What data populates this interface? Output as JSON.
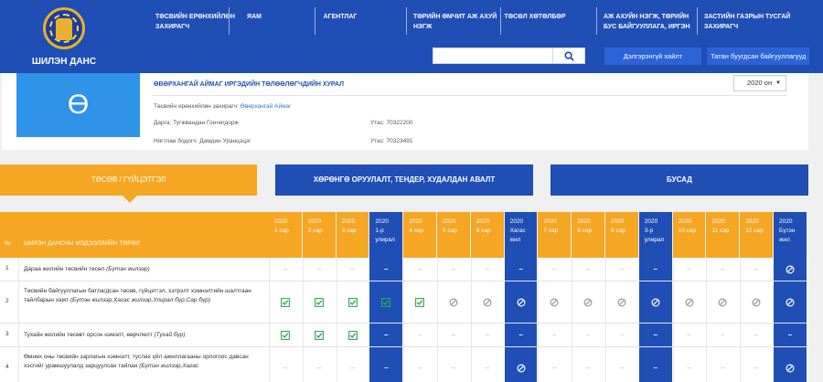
{
  "site": {
    "title": "ШИЛЭН ДАНС"
  },
  "nav": [
    {
      "line1": "ТӨСВИЙН ЕРӨНХИЙЛӨН",
      "line2": "ЗАХИРАГЧ"
    },
    {
      "line1": "ЯАМ",
      "line2": ""
    },
    {
      "line1": "АГЕНТЛАГ",
      "line2": ""
    },
    {
      "line1": "ТӨРИЙН ӨМЧИТ АЖ АХУЙ",
      "line2": "НЭГЖ"
    },
    {
      "line1": "ТӨСӨЛ ХӨТӨЛБӨР",
      "line2": ""
    },
    {
      "line1": "АЖ АХУЙН НЭГЖ, ТӨРИЙН",
      "line2": "БУС БАЙГУУЛЛАГА, ИРГЭН"
    },
    {
      "line1": "ЗАСТИЙН ГАЗРЫН ТУСГАЙ",
      "line2": "ЗАХИРАГЧ"
    }
  ],
  "search": {
    "value": "",
    "placeholder": ""
  },
  "buttons": {
    "advanced": "Дэлгэрэнгүй хайлт",
    "download": "Татан буугдсан байгууллагууд"
  },
  "org": {
    "initial": "Ө",
    "name": "ӨВӨРХАНГАЙ АЙМАГ ИРГЭДИЙН ТӨЛӨӨЛӨГЧДИЙН ХУРАЛ",
    "year": "2020 он",
    "manager_label": "Төсвийн ерөнхийлөн захирагч:",
    "manager_value": "Өвөрхангай Аймаг",
    "head": "Дарга: Тугжвандан Гончигдорж",
    "head_phone": "Утас: 70322200",
    "accountant": "Нягтлан бодогч: Дамдин Уранцэцэг",
    "accountant_phone": "Утас: 70323491"
  },
  "tabs": {
    "budget": "ТӨСӨВ / ГҮЙЦЭТГЭЛ",
    "procurement": "ХӨРӨНГӨ ОРУУЛАЛТ, ТЕНДЕР, ХУДАЛДАН АВАЛТ",
    "other": "БУСАД"
  },
  "table": {
    "num_header": "№",
    "label_header": "ШИЛЭН ДАНСНЫ МЭДЭЭЛЛИЙН ТӨРӨЛ",
    "columns": [
      {
        "top": "2020",
        "bottom": "1 сар",
        "kind": "month"
      },
      {
        "top": "2020",
        "bottom": "2 сар",
        "kind": "month"
      },
      {
        "top": "2020",
        "bottom": "3 сар",
        "kind": "month"
      },
      {
        "top": "2020",
        "bottom": "1-р",
        "extra": "улирал",
        "kind": "period"
      },
      {
        "top": "2020",
        "bottom": "4 сар",
        "kind": "month"
      },
      {
        "top": "2020",
        "bottom": "5 сар",
        "kind": "month"
      },
      {
        "top": "2020",
        "bottom": "6 сар",
        "kind": "month"
      },
      {
        "top": "2020",
        "bottom": "Хагас",
        "extra": "жил",
        "kind": "period"
      },
      {
        "top": "2020",
        "bottom": "7 сар",
        "kind": "month"
      },
      {
        "top": "2020",
        "bottom": "8 сар",
        "kind": "month"
      },
      {
        "top": "2020",
        "bottom": "9 сар",
        "kind": "month"
      },
      {
        "top": "2020",
        "bottom": "3-р",
        "extra": "улирал",
        "kind": "period"
      },
      {
        "top": "2020",
        "bottom": "10 сар",
        "kind": "month"
      },
      {
        "top": "2020",
        "bottom": "11 сар",
        "kind": "month"
      },
      {
        "top": "2020",
        "bottom": "12 сар",
        "kind": "month"
      },
      {
        "top": "2020",
        "bottom": "Бүтэн",
        "extra": "жил",
        "kind": "period"
      }
    ],
    "rows": [
      {
        "num": "1",
        "text": "Дараа жилийн төсвийн төсөл",
        "italic": "(Бүтэн жилээр)",
        "marks": [
          "dash",
          "dash",
          "dash",
          "wdash",
          "dash",
          "dash",
          "dash",
          "wdash",
          "dash",
          "dash",
          "dash",
          "wdash",
          "dash",
          "dash",
          "dash",
          "block"
        ]
      },
      {
        "num": "2",
        "text": "Төсвийн байгууллагын батлагдсан төсөв, гүйцэтгэл, хэтрэлт хэмнэлтийн шалтгаан тайлбарын хамт",
        "italic": "(Бүтэн жилээр,Хагас жилээр,Улирал бүр,Сар бүр)",
        "marks": [
          "check",
          "check",
          "check",
          "check",
          "check",
          "block",
          "block",
          "block",
          "block",
          "block",
          "block",
          "block",
          "block",
          "block",
          "block",
          "block"
        ]
      },
      {
        "num": "3",
        "text": "Тухайн жилийн төсөвт орсон нэмэлт, өөрчлөлт",
        "italic": "(Тухай бүр)",
        "marks": [
          "check",
          "check",
          "check",
          "wdash",
          "dash",
          "dash",
          "dash",
          "wdash",
          "dash",
          "dash",
          "dash",
          "wdash",
          "dash",
          "dash",
          "dash",
          "wdash"
        ]
      },
      {
        "num": "4",
        "text": "Өмнөх оны төсвийн зарлагын хэмнэлт, туслах үйл ажиллагааны орлогоос давсан хэсгийг урамшуулалд зарцуулсан тайлан",
        "italic": "(Бүтэн жилээр,Хагас",
        "marks": [
          "dash",
          "dash",
          "dash",
          "wdash",
          "dash",
          "dash",
          "dash",
          "block",
          "dash",
          "dash",
          "dash",
          "wdash",
          "dash",
          "dash",
          "dash",
          "block"
        ]
      }
    ]
  }
}
